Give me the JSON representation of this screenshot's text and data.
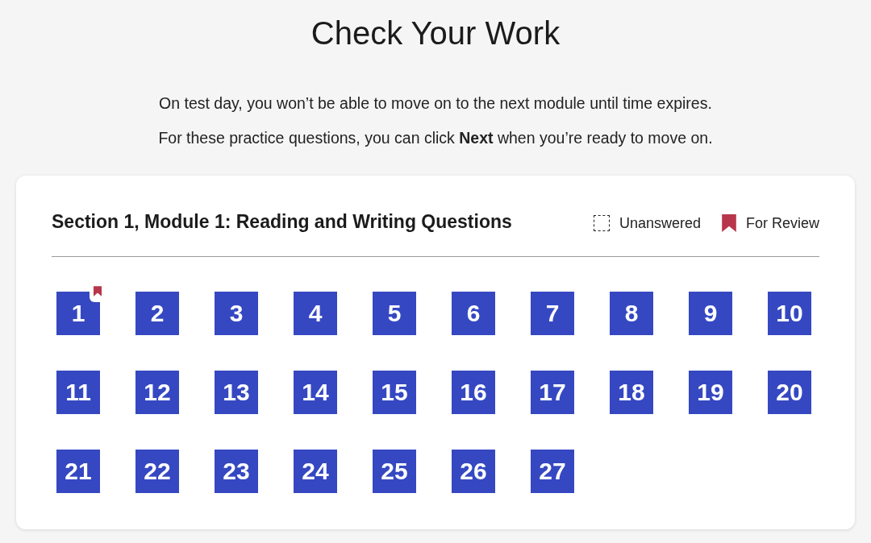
{
  "title": "Check Your Work",
  "notes": [
    "On test day, you won’t be able to move on to the next module until time expires.",
    "For these practice questions, you can click **Next** when you’re ready to move on."
  ],
  "section": {
    "heading": "Section 1, Module 1: Reading and Writing Questions",
    "legend": [
      {
        "kind": "unanswered",
        "label": "Unanswered"
      },
      {
        "kind": "review",
        "label": "For Review"
      }
    ],
    "questions": [
      {
        "number": "1",
        "answered": true,
        "for_review": true
      },
      {
        "number": "2",
        "answered": true,
        "for_review": false
      },
      {
        "number": "3",
        "answered": true,
        "for_review": false
      },
      {
        "number": "4",
        "answered": true,
        "for_review": false
      },
      {
        "number": "5",
        "answered": true,
        "for_review": false
      },
      {
        "number": "6",
        "answered": true,
        "for_review": false
      },
      {
        "number": "7",
        "answered": true,
        "for_review": false
      },
      {
        "number": "8",
        "answered": true,
        "for_review": false
      },
      {
        "number": "9",
        "answered": true,
        "for_review": false
      },
      {
        "number": "10",
        "answered": true,
        "for_review": false
      },
      {
        "number": "11",
        "answered": true,
        "for_review": false
      },
      {
        "number": "12",
        "answered": true,
        "for_review": false
      },
      {
        "number": "13",
        "answered": true,
        "for_review": false
      },
      {
        "number": "14",
        "answered": true,
        "for_review": false
      },
      {
        "number": "15",
        "answered": true,
        "for_review": false
      },
      {
        "number": "16",
        "answered": true,
        "for_review": false
      },
      {
        "number": "17",
        "answered": true,
        "for_review": false
      },
      {
        "number": "18",
        "answered": true,
        "for_review": false
      },
      {
        "number": "19",
        "answered": true,
        "for_review": false
      },
      {
        "number": "20",
        "answered": true,
        "for_review": false
      },
      {
        "number": "21",
        "answered": true,
        "for_review": false
      },
      {
        "number": "22",
        "answered": true,
        "for_review": false
      },
      {
        "number": "23",
        "answered": true,
        "for_review": false
      },
      {
        "number": "24",
        "answered": true,
        "for_review": false
      },
      {
        "number": "25",
        "answered": true,
        "for_review": false
      },
      {
        "number": "26",
        "answered": true,
        "for_review": false
      },
      {
        "number": "27",
        "answered": true,
        "for_review": false
      }
    ]
  }
}
